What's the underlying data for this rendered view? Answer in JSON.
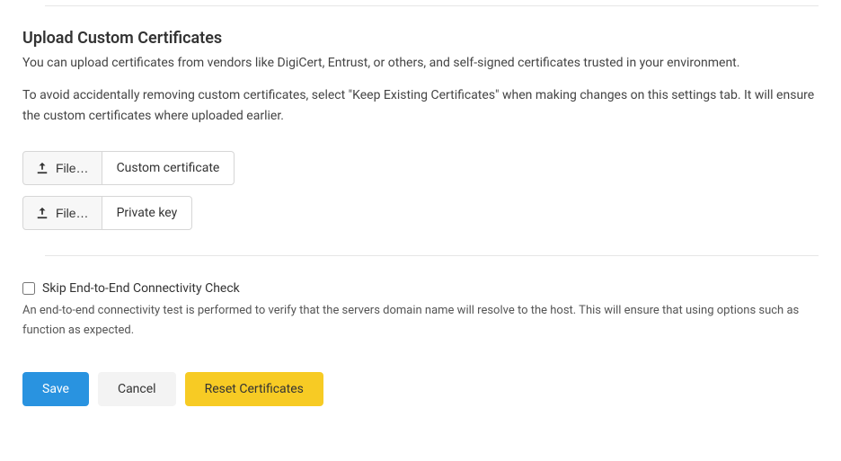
{
  "upload": {
    "title": "Upload Custom Certificates",
    "desc": "You can upload certificates from vendors like DigiCert, Entrust, or others, and self-signed certificates trusted in your environment.",
    "note": "To avoid accidentally removing custom certificates, select \"Keep Existing Certificates\" when making changes on this settings tab. It will ensure the custom certificates where uploaded earlier.",
    "fileButton": "File…",
    "customCertLabel": "Custom certificate",
    "privateKeyLabel": "Private key"
  },
  "check": {
    "label": "Skip End-to-End Connectivity Check",
    "desc": "An end-to-end connectivity test is performed to verify that the servers domain name will resolve to the host. This will ensure that using options such as function as expected.",
    "checked": false
  },
  "buttons": {
    "save": "Save",
    "cancel": "Cancel",
    "reset": "Reset Certificates"
  }
}
